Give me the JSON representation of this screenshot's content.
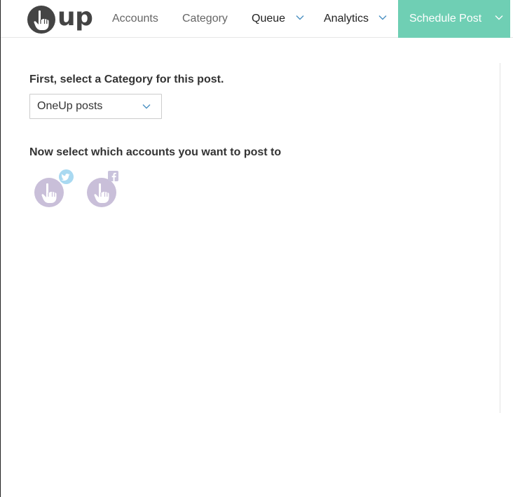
{
  "brand": {
    "logo_text": "up"
  },
  "nav": {
    "items": [
      {
        "label": "Accounts",
        "dropdown": false
      },
      {
        "label": "Category",
        "dropdown": false
      },
      {
        "label": "Queue",
        "dropdown": true
      },
      {
        "label": "Analytics",
        "dropdown": true
      }
    ],
    "cta": {
      "label": "Schedule Post",
      "dropdown": true
    }
  },
  "main": {
    "category_prompt": "First, select a Category for this post.",
    "category_select": {
      "value": "OneUp posts"
    },
    "accounts_prompt": "Now select which accounts you want to post to",
    "accounts": [
      {
        "network": "twitter",
        "badge_icon": "twitter-icon"
      },
      {
        "network": "facebook",
        "badge_icon": "facebook-icon"
      }
    ]
  },
  "colors": {
    "accent": "#6fcfb4",
    "avatar": "#c9bfd9",
    "twitter_badge": "#a9d9f1",
    "facebook_badge": "#c9c3dc",
    "chevron": "#4a90c2"
  }
}
